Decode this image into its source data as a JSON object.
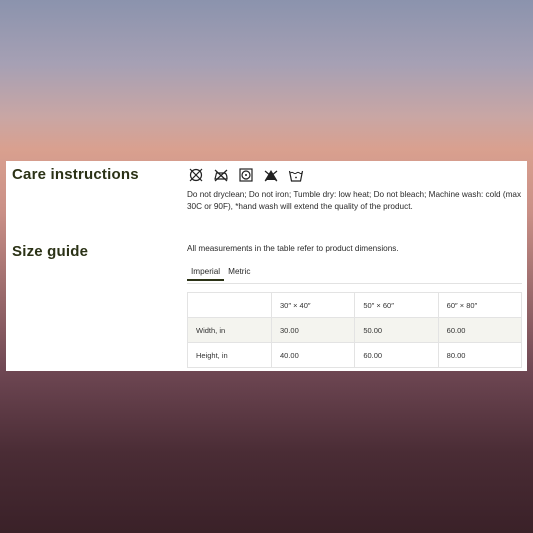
{
  "care": {
    "title": "Care instructions",
    "icons": [
      "do-not-dryclean-icon",
      "do-not-iron-icon",
      "tumble-dry-low-icon",
      "do-not-bleach-icon",
      "machine-wash-cold-icon"
    ],
    "text": "Do not dryclean; Do not iron; Tumble dry: low heat; Do not bleach; Machine wash: cold (max 30C or 90F), *hand wash will extend the quality of the product."
  },
  "size": {
    "title": "Size guide",
    "intro": "All measurements in the table refer to product dimensions.",
    "tabs": [
      {
        "label": "Imperial",
        "active": true
      },
      {
        "label": "Metric",
        "active": false
      }
    ],
    "table": {
      "columns": [
        "",
        "30″ × 40″",
        "50″ × 60″",
        "60″ × 80″"
      ],
      "rows": [
        {
          "label": "Width, in",
          "values": [
            "30.00",
            "50.00",
            "60.00"
          ]
        },
        {
          "label": "Height, in",
          "values": [
            "40.00",
            "60.00",
            "80.00"
          ]
        }
      ]
    }
  },
  "colors": {
    "heading": "#2b3216",
    "tab_underline": "#2b3216",
    "row_shade": "#f4f4ef"
  }
}
